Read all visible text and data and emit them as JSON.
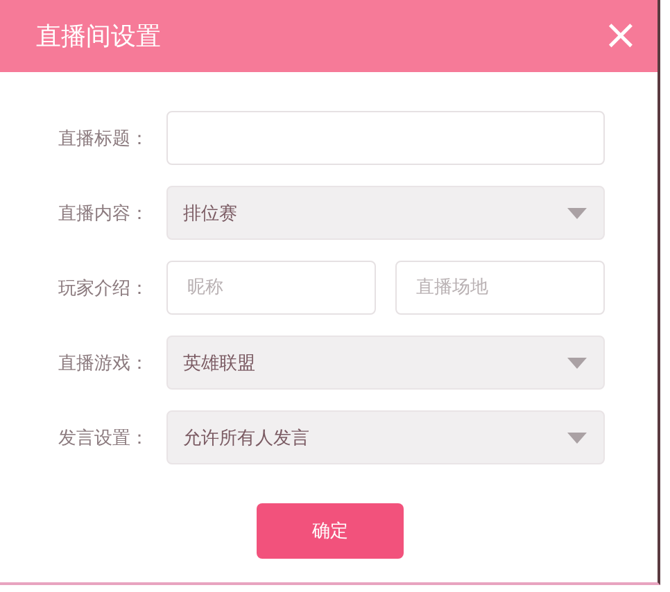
{
  "dialog": {
    "title": "直播间设置",
    "close": "×"
  },
  "fields": [
    {
      "kind": "text",
      "label": "直播标题："
    },
    {
      "kind": "select",
      "label": "直播内容：",
      "value": "排位赛"
    },
    {
      "kind": "pair",
      "label": "玩家介绍：",
      "inputs": [
        {
          "placeholder": "昵称"
        },
        {
          "placeholder": "直播场地"
        }
      ]
    },
    {
      "kind": "select",
      "label": "直播游戏：",
      "value": "英雄联盟"
    },
    {
      "kind": "select",
      "label": "发言设置：",
      "value": "允许所有人发言"
    }
  ],
  "confirm": "确定"
}
